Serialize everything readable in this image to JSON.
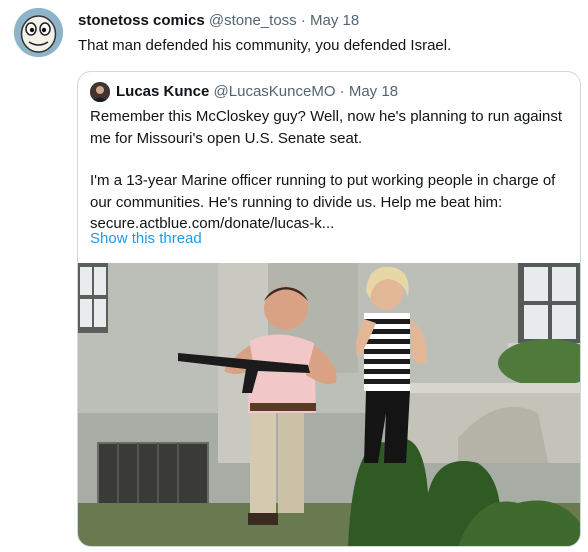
{
  "tweet": {
    "display_name": "stonetoss comics",
    "handle": "@stone_toss",
    "separator": "·",
    "date": "May 18",
    "text": "That man defended his community, you defended Israel."
  },
  "quoted_tweet": {
    "display_name": "Lucas Kunce",
    "handle": "@LucasKunceMO",
    "separator": "·",
    "date": "May 18",
    "lines": [
      "Remember this McCloskey guy? Well, now he's planning to run against",
      "me for Missouri's open U.S. Senate seat.",
      "I'm a 13-year Marine officer running to put working people in charge of",
      "our communities. He's running to divide us. Help me beat him:",
      "secure.actblue.com/donate/lucas-k..."
    ],
    "show_thread": "Show this thread"
  },
  "colors": {
    "link": "#1d9bf0",
    "secondary_text": "#536471",
    "border": "#cfd9de"
  }
}
